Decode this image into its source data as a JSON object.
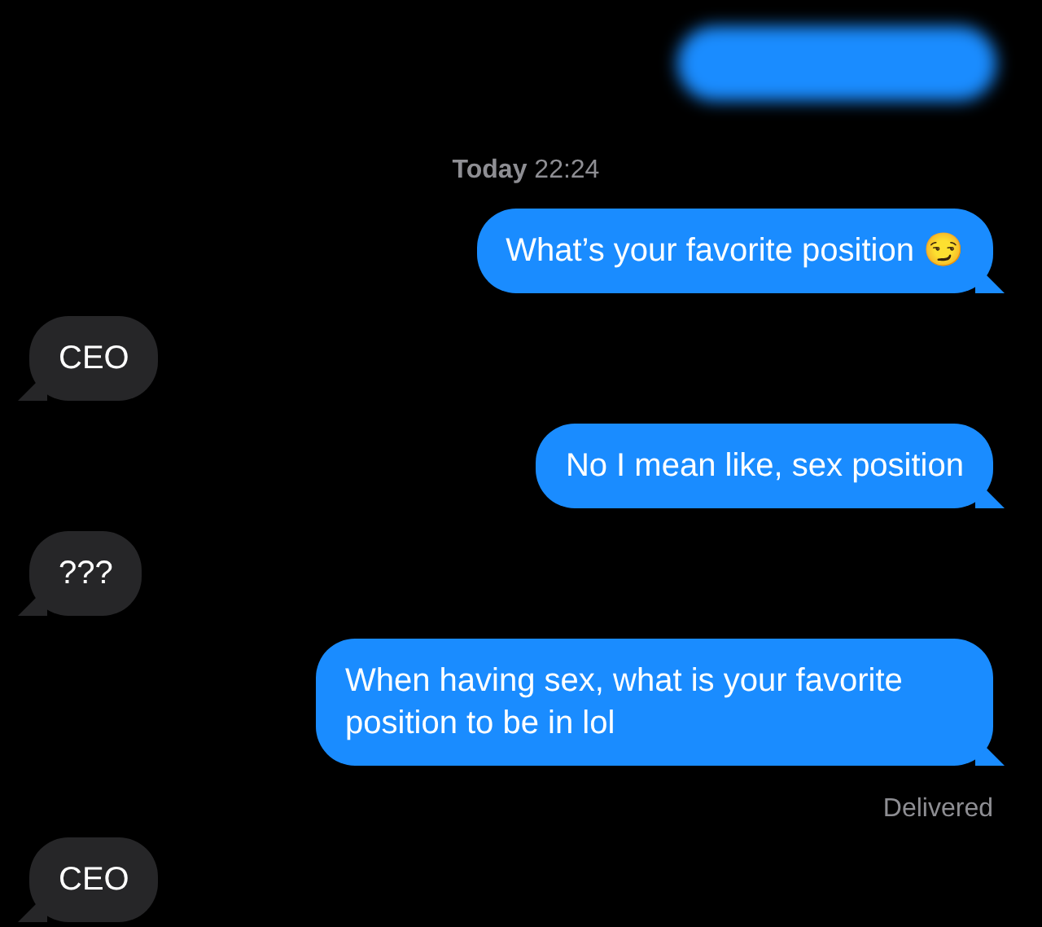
{
  "messages": [
    {
      "kind": "blurred"
    },
    {
      "kind": "timestamp",
      "text": "**Today** 22:24"
    },
    {
      "kind": "sent",
      "text": "What’s your favorite position 😏"
    },
    {
      "kind": "received",
      "text": "CEO"
    },
    {
      "kind": "sent",
      "text": "No I mean like, sex position"
    },
    {
      "kind": "received",
      "text": "???"
    },
    {
      "kind": "sent",
      "text": "When having sex, what is your favorite position to be in lol"
    },
    {
      "kind": "status",
      "text": "Delivered"
    },
    {
      "kind": "received",
      "text": "CEO"
    }
  ]
}
